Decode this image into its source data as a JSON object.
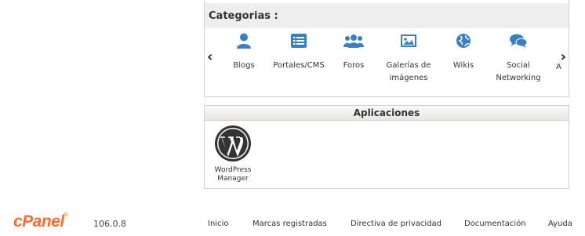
{
  "categories": {
    "title": "Categorias :",
    "prev_arrow": "‹",
    "next_arrow": "›",
    "items": [
      {
        "label": "Blogs",
        "icon": "user-icon"
      },
      {
        "label": "Portales/CMS",
        "icon": "list-icon"
      },
      {
        "label": "Foros",
        "icon": "users-icon"
      },
      {
        "label": "Galerías de imágenes",
        "icon": "image-icon"
      },
      {
        "label": "Wikis",
        "icon": "globe-icon"
      },
      {
        "label": "Social Networking",
        "icon": "chat-icon"
      }
    ],
    "cut_off_text": "A"
  },
  "applications": {
    "title": "Aplicaciones",
    "items": [
      {
        "label": "WordPress Manager",
        "icon": "wordpress-icon"
      }
    ]
  },
  "footer": {
    "logo": "cPanel",
    "logo_mark": "®",
    "version": "106.0.8",
    "links": [
      "Inicio",
      "Marcas registradas",
      "Directiva de privacidad",
      "Documentación",
      "Ayuda"
    ]
  },
  "colors": {
    "icon_blue": "#3a80c1",
    "cpanel_orange": "#ff6c2c",
    "header_bg": "#eeeeee"
  }
}
